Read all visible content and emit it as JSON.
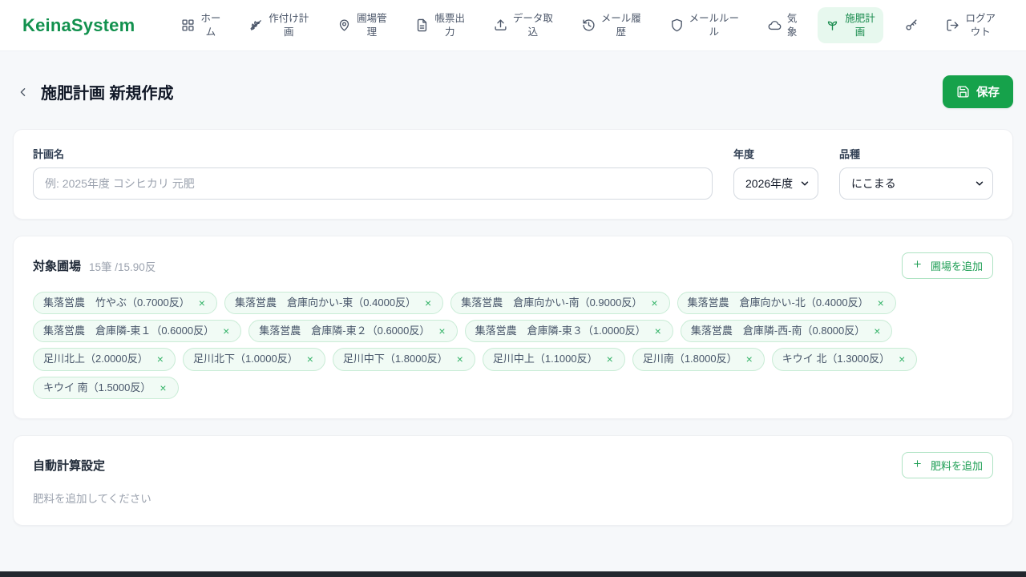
{
  "brand": "KeinaSystem",
  "ui": {
    "close_glyph": "×"
  },
  "nav": {
    "items": [
      {
        "id": "home",
        "icon": "grid-icon",
        "label": "ホー\nム",
        "active": false
      },
      {
        "id": "planting-plan",
        "icon": "wheat-icon",
        "label": "作付け計\n画",
        "active": false
      },
      {
        "id": "field-mgmt",
        "icon": "map-pin-icon",
        "label": "圃場管\n理",
        "active": false
      },
      {
        "id": "report-output",
        "icon": "document-icon",
        "label": "帳票出\n力",
        "active": false
      },
      {
        "id": "data-import",
        "icon": "upload-icon",
        "label": "データ取\n込",
        "active": false
      },
      {
        "id": "mail-history",
        "icon": "history-icon",
        "label": "メール履\n歴",
        "active": false
      },
      {
        "id": "mail-rules",
        "icon": "shield-icon",
        "label": "メールルー\nル",
        "active": false
      },
      {
        "id": "weather",
        "icon": "cloud-icon",
        "label": "気\n象",
        "active": false
      },
      {
        "id": "fertilization-plan",
        "icon": "sprout-icon",
        "label": "施肥計\n画",
        "active": true
      },
      {
        "id": "password",
        "icon": "key-icon",
        "label": "",
        "active": false
      },
      {
        "id": "logout",
        "icon": "logout-icon",
        "label": "ログア\nウト",
        "active": false
      }
    ]
  },
  "header": {
    "title": "施肥計画 新規作成",
    "save_label": "保存"
  },
  "plan_form": {
    "name_label": "計画名",
    "name_placeholder": "例: 2025年度 コシヒカリ 元肥",
    "name_value": "",
    "year_label": "年度",
    "year_value": "2026年度",
    "variety_label": "品種",
    "variety_value": "にこまる"
  },
  "fields_section": {
    "title": "対象圃場",
    "count_text": "15筆 /15.90反",
    "add_button_label": "圃場を追加",
    "tags": [
      "集落営農　竹やぶ（0.7000反）",
      "集落営農　倉庫向かい-東（0.4000反）",
      "集落営農　倉庫向かい-南（0.9000反）",
      "集落営農　倉庫向かい-北（0.4000反）",
      "集落営農　倉庫隣-東１（0.6000反）",
      "集落営農　倉庫隣-東２（0.6000反）",
      "集落営農　倉庫隣-東３（1.0000反）",
      "集落営農　倉庫隣-西-南（0.8000反）",
      "足川北上（2.0000反）",
      "足川北下（1.0000反）",
      "足川中下（1.8000反）",
      "足川中上（1.1000反）",
      "足川南（1.8000反）",
      "キウイ 北（1.3000反）",
      "キウイ 南（1.5000反）"
    ]
  },
  "fertilizer_section": {
    "title": "自動計算設定",
    "add_button_label": "肥料を追加",
    "empty_text": "肥料を追加してください"
  },
  "colors": {
    "brand_green": "#12914e",
    "accent_green": "#16a24b",
    "active_nav_bg": "#e7f8ee",
    "tag_bg": "#f1fbf5",
    "tag_border": "#c9ecd6"
  }
}
